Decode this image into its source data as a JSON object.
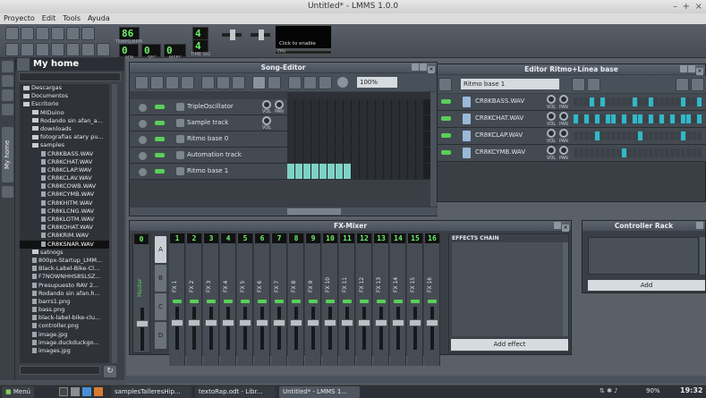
{
  "window": {
    "title": "Untitled* - LMMS 1.0.0"
  },
  "menu": [
    "Proyecto",
    "Edit",
    "Tools",
    "Ayuda"
  ],
  "toolbar": {
    "tempo": "86",
    "tempo_label": "TEMPO/BPM",
    "min": "0",
    "sec": "0",
    "msec": "0",
    "min_label": "MIN",
    "sec_label": "SEC",
    "msec_label": "MSEC",
    "timesig_top": "4",
    "timesig_bottom": "4",
    "timesig_label": "TIME SIG",
    "enable_hint": "Click to enable",
    "cpu_label": "CPU"
  },
  "browser": {
    "title": "My home",
    "side_tab": "My home",
    "items": [
      {
        "label": "Descargas",
        "type": "folder",
        "indent": 0
      },
      {
        "label": "Documentos",
        "type": "folder",
        "indent": 0
      },
      {
        "label": "Escritorio",
        "type": "folder",
        "indent": 0
      },
      {
        "label": "MIDuino",
        "type": "folder",
        "indent": 1
      },
      {
        "label": "Rodando sin afan_a...",
        "type": "folder",
        "indent": 1
      },
      {
        "label": "downloads",
        "type": "folder",
        "indent": 1
      },
      {
        "label": "fotografias atary pu...",
        "type": "folder",
        "indent": 1
      },
      {
        "label": "samples",
        "type": "folder",
        "indent": 1
      },
      {
        "label": "CR8KBASS.WAV",
        "type": "wav",
        "indent": 2
      },
      {
        "label": "CR8KCHAT.WAV",
        "type": "wav",
        "indent": 2
      },
      {
        "label": "CR8KCLAP.WAV",
        "type": "wav",
        "indent": 2
      },
      {
        "label": "CR8KCLAV.WAV",
        "type": "wav",
        "indent": 2
      },
      {
        "label": "CR8KCOWB.WAV",
        "type": "wav",
        "indent": 2
      },
      {
        "label": "CR8KCYMB.WAV",
        "type": "wav",
        "indent": 2
      },
      {
        "label": "CR8KHITM.WAV",
        "type": "wav",
        "indent": 2
      },
      {
        "label": "CR8KLCNG.WAV",
        "type": "wav",
        "indent": 2
      },
      {
        "label": "CR8KLOTM.WAV",
        "type": "wav",
        "indent": 2
      },
      {
        "label": "CR8KOHAT.WAV",
        "type": "wav",
        "indent": 2
      },
      {
        "label": "CR8KRIM.WAV",
        "type": "wav",
        "indent": 2
      },
      {
        "label": "CR8KSNAR.WAV",
        "type": "wav",
        "indent": 2,
        "selected": true
      },
      {
        "label": "satnogs",
        "type": "folder",
        "indent": 1
      },
      {
        "label": "800px-Startup_LMM...",
        "type": "file",
        "indent": 1
      },
      {
        "label": "Black-Label-Bike-Cl...",
        "type": "file",
        "indent": 1
      },
      {
        "label": "F7NOWNHHS8SLSZ...",
        "type": "file",
        "indent": 1
      },
      {
        "label": "Presupuesto RAV 2...",
        "type": "file",
        "indent": 1
      },
      {
        "label": "Rodando sin afan.h...",
        "type": "file",
        "indent": 1
      },
      {
        "label": "barrs1.png",
        "type": "file",
        "indent": 1
      },
      {
        "label": "bass.png",
        "type": "file",
        "indent": 1
      },
      {
        "label": "black-label-bike-clu...",
        "type": "file",
        "indent": 1
      },
      {
        "label": "controller.png",
        "type": "file",
        "indent": 1
      },
      {
        "label": "image.jpg",
        "type": "file",
        "indent": 1
      },
      {
        "label": "image.duckduckgo...",
        "type": "file",
        "indent": 1
      },
      {
        "label": "images.jpg",
        "type": "file",
        "indent": 1
      }
    ]
  },
  "song_editor": {
    "title": "Song-Editor",
    "zoom": "100%",
    "tracks": [
      {
        "name": "TripleOscillator",
        "knobs": [
          "VOL",
          "PAN"
        ],
        "pattern": []
      },
      {
        "name": "Sample track",
        "knobs": [
          "VOL"
        ],
        "pattern": []
      },
      {
        "name": "Ritmo base 0",
        "knobs": [],
        "pattern": []
      },
      {
        "name": "Automation track",
        "knobs": [],
        "pattern": []
      },
      {
        "name": "Ritmo base 1",
        "knobs": [],
        "pattern": [
          0,
          1,
          2,
          3,
          4,
          5,
          6,
          7
        ]
      }
    ]
  },
  "beat_editor": {
    "title": "Editor Ritmo+Línea base",
    "selected": "Ritmo base 1",
    "tracks": [
      {
        "name": "CR8KBASS.WAV",
        "steps": [
          0,
          0,
          0,
          1,
          0,
          1,
          0,
          0,
          0,
          0,
          0,
          1,
          0,
          0,
          1,
          0,
          0,
          0,
          0,
          0,
          1,
          0,
          0,
          1,
          0,
          0,
          0,
          0,
          0,
          1,
          0,
          0
        ]
      },
      {
        "name": "CR8KCHAT.WAV",
        "steps": [
          1,
          0,
          1,
          0,
          1,
          0,
          1,
          1,
          0,
          1,
          0,
          1,
          1,
          0,
          1,
          0,
          1,
          0,
          1,
          0,
          1,
          1,
          0,
          1,
          0,
          1,
          1,
          0,
          1,
          0,
          1,
          0
        ]
      },
      {
        "name": "CR8KCLAP.WAV",
        "steps": [
          0,
          0,
          0,
          0,
          1,
          0,
          0,
          0,
          0,
          0,
          0,
          0,
          1,
          0,
          0,
          0,
          0,
          0,
          0,
          0,
          1,
          0,
          0,
          0,
          0,
          0,
          0,
          0,
          1,
          0,
          0,
          0
        ]
      },
      {
        "name": "CR8KCYMB.WAV",
        "steps": [
          0,
          0,
          0,
          0,
          0,
          0,
          0,
          0,
          0,
          1,
          0,
          0,
          0,
          0,
          0,
          0,
          0,
          0,
          0,
          0,
          0,
          0,
          0,
          0,
          0,
          0,
          0,
          0,
          0,
          1,
          0,
          0
        ]
      }
    ],
    "knob_labels": [
      "VOL",
      "PAN"
    ]
  },
  "fx_mixer": {
    "title": "FX-Mixer",
    "master_num": "0",
    "master_label": "Master",
    "channels": [
      "1",
      "2",
      "3",
      "4",
      "5",
      "6",
      "7",
      "8",
      "9",
      "10",
      "11",
      "12",
      "13",
      "14",
      "15",
      "16"
    ],
    "channel_labels": [
      "FX 1",
      "FX 2",
      "FX 3",
      "FX 4",
      "FX 5",
      "FX 6",
      "FX 7",
      "FX 8",
      "FX 9",
      "FX 10",
      "FX 11",
      "FX 12",
      "FX 13",
      "FX 14",
      "FX 15",
      "FX 16"
    ],
    "banks": [
      "A",
      "B",
      "C",
      "D"
    ],
    "effects_chain": "EFFECTS CHAIN",
    "add_effect": "Add effect"
  },
  "controller_rack": {
    "title": "Controller Rack",
    "add": "Add"
  },
  "taskbar": {
    "menu": "Menú",
    "tasks": [
      "samplesTalleresHip...",
      "textoRap.odt - Libr...",
      "Untitled* - LMMS 1..."
    ],
    "battery": "90%",
    "clock": "19:32"
  },
  "colors": {
    "lcd_green": "#6cf06a",
    "led_green": "#58d058",
    "pattern_teal": "#7fd1c6",
    "beat_on": "#2fb9c8"
  }
}
